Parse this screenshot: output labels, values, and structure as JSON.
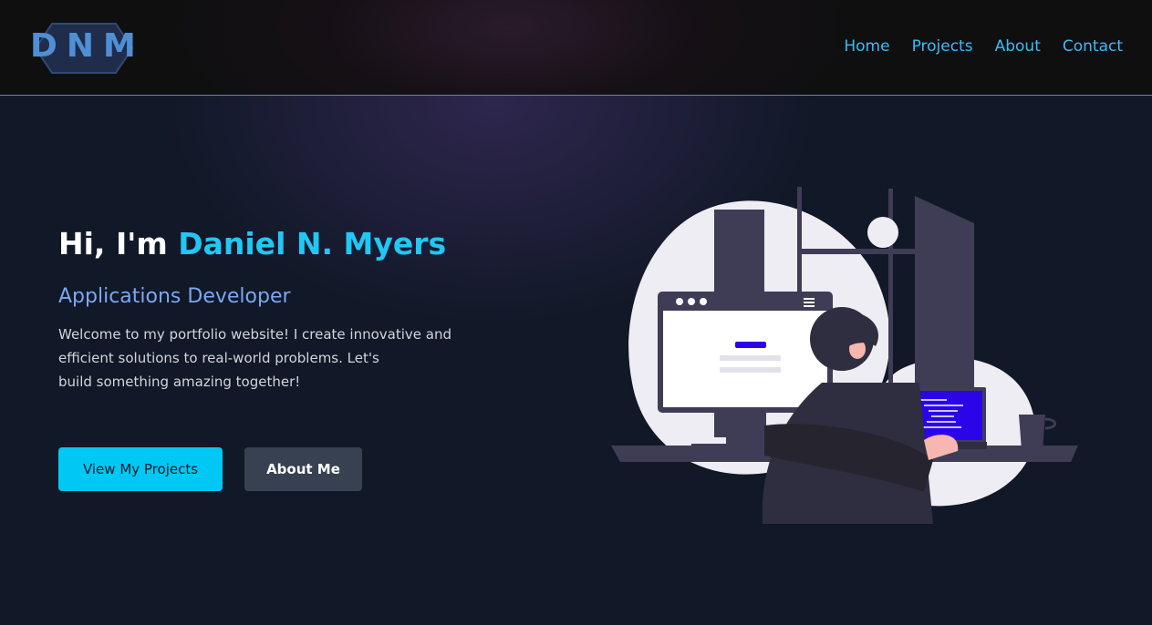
{
  "brand": {
    "logo_text": "DNM"
  },
  "nav": {
    "items": [
      "Home",
      "Projects",
      "About",
      "Contact"
    ]
  },
  "hero": {
    "greeting": "Hi, I'm ",
    "name": "Daniel N. Myers",
    "role": "Applications Developer",
    "description_lines": [
      "Welcome to my portfolio website! I create innovative and",
      "efficient solutions to real-world problems. Let's",
      "build something amazing together!"
    ],
    "primary_button": "View My Projects",
    "secondary_button": "About Me"
  },
  "illustration": {
    "icon": "developer-at-desk-illustration"
  },
  "colors": {
    "background": "#111827",
    "header_bg": "#0f0f10",
    "accent_cyan": "#22c7f5",
    "role_blue": "#7aa7f0",
    "nav_link": "#38bdf8",
    "secondary_button": "#374151",
    "header_border": "#5b82c9"
  }
}
